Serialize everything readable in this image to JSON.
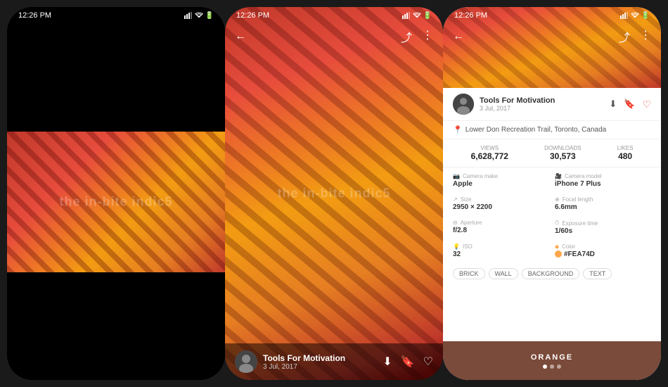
{
  "screens": {
    "screen1": {
      "status_time": "12:26 PM",
      "image_alt": "brick wall with orange shadow art"
    },
    "screen2": {
      "status_time": "12:26 PM",
      "author_name": "Tools For Motivation",
      "author_date": "3 Jul, 2017",
      "watermark": "the in-bite indic5"
    },
    "screen3": {
      "status_time": "12:26 PM",
      "author_name": "Tools For Motivation",
      "author_date": "3 Jul, 2017",
      "location": "Lower Don Recreation Trail, Toronto, Canada",
      "stats": {
        "views_label": "Views",
        "views_value": "6,628,772",
        "downloads_label": "Downloads",
        "downloads_value": "30,573",
        "likes_label": "Likes",
        "likes_value": "480"
      },
      "meta": {
        "camera_make_label": "Camera make",
        "camera_make_value": "Apple",
        "camera_model_label": "Camera model",
        "camera_model_value": "iPhone 7 Plus",
        "size_label": "Size",
        "size_value": "2950 × 2200",
        "focal_length_label": "Focal length",
        "focal_length_value": "6.6mm",
        "aperture_label": "Aperture",
        "aperture_value": "f/2.8",
        "exposure_label": "Exposure time",
        "exposure_value": "1/60s",
        "iso_label": "ISO",
        "iso_value": "32",
        "color_label": "Color",
        "color_value": "#FEA74D"
      },
      "tags": [
        "BRICK",
        "WALL",
        "BACKGROUND",
        "TEXT"
      ],
      "banner_label": "ORANGE"
    }
  }
}
